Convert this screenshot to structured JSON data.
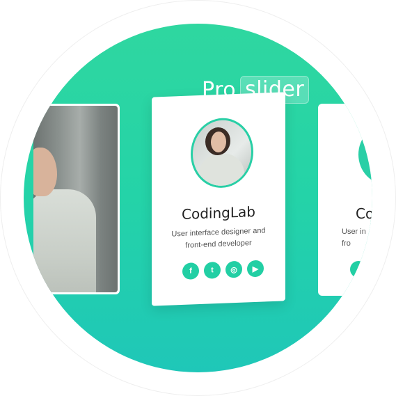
{
  "header": {
    "title_plain": "Pro",
    "title_highlight": "slider"
  },
  "card": {
    "name": "CodingLab",
    "description_line1": "User interface designer and",
    "description_line2": "front-end developer",
    "socials": [
      {
        "icon": "facebook-icon",
        "glyph": "f"
      },
      {
        "icon": "twitter-icon",
        "glyph": "t"
      },
      {
        "icon": "instagram-icon",
        "glyph": "◎"
      },
      {
        "icon": "youtube-icon",
        "glyph": "▶"
      }
    ]
  },
  "right_card": {
    "name_partial": "Co",
    "description_line1_partial": "User in",
    "description_line2_partial": "fro"
  },
  "colors": {
    "gradient_top": "#2fd7a0",
    "gradient_bottom": "#1fc7b8",
    "accent": "#22cfa4"
  }
}
